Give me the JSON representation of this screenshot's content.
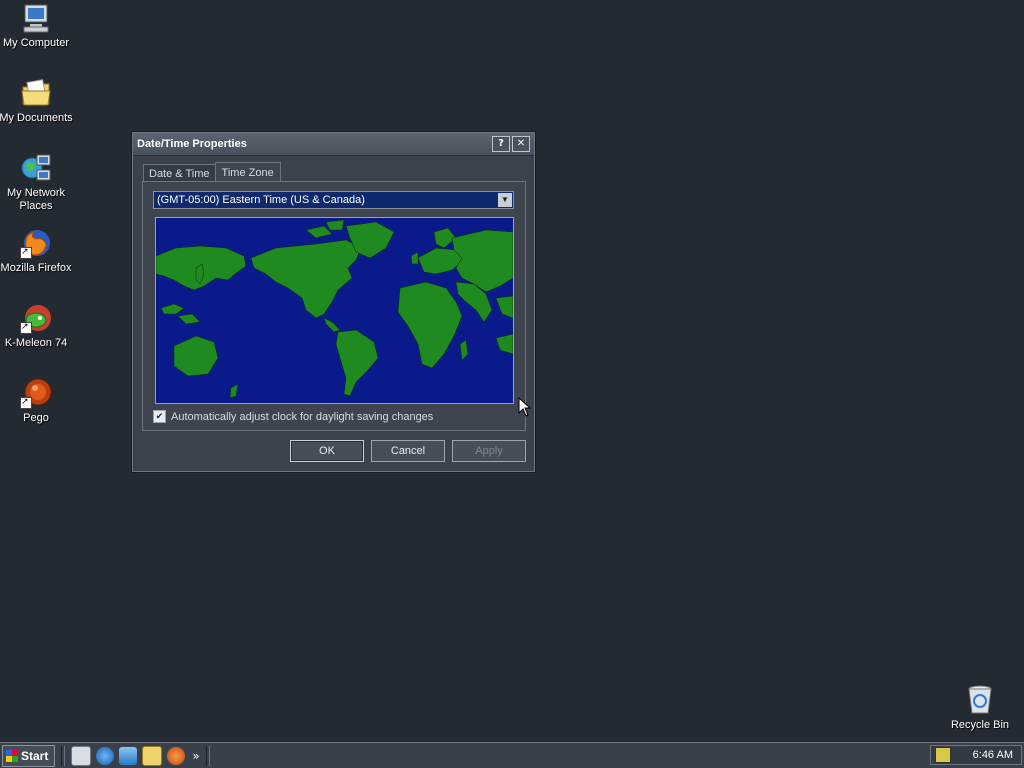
{
  "desktop": {
    "icons": [
      {
        "label": "My Computer",
        "icon": "computer-icon"
      },
      {
        "label": "My Documents",
        "icon": "documents-folder-icon"
      },
      {
        "label": "My Network Places",
        "icon": "network-places-icon"
      },
      {
        "label": "Mozilla Firefox",
        "icon": "firefox-icon"
      },
      {
        "label": "K-Meleon 74",
        "icon": "kmeleon-icon"
      },
      {
        "label": "Pego",
        "icon": "pego-icon"
      }
    ],
    "recycle_bin": {
      "label": "Recycle Bin",
      "icon": "recycle-bin-icon"
    }
  },
  "dialog": {
    "title": "Date/Time Properties",
    "help_button": "?",
    "close_button": "✕",
    "tabs": [
      {
        "label": "Date & Time",
        "active": false
      },
      {
        "label": "Time Zone",
        "active": true
      }
    ],
    "timezone_select": "(GMT-05:00) Eastern Time (US & Canada)",
    "daylight_checkbox": {
      "label": "Automatically adjust clock for daylight saving changes",
      "checked": true
    },
    "buttons": {
      "ok": "OK",
      "cancel": "Cancel",
      "apply": "Apply"
    },
    "colors": {
      "ocean": "#0b1a8a",
      "land": "#1f8a1f"
    }
  },
  "taskbar": {
    "start_label": "Start",
    "quick_launch": [
      "show-desktop-icon",
      "internet-explorer-icon",
      "outlook-icon",
      "explorer-icon",
      "firefox-icon"
    ],
    "more_label": "»",
    "clock": "6:46 AM"
  }
}
